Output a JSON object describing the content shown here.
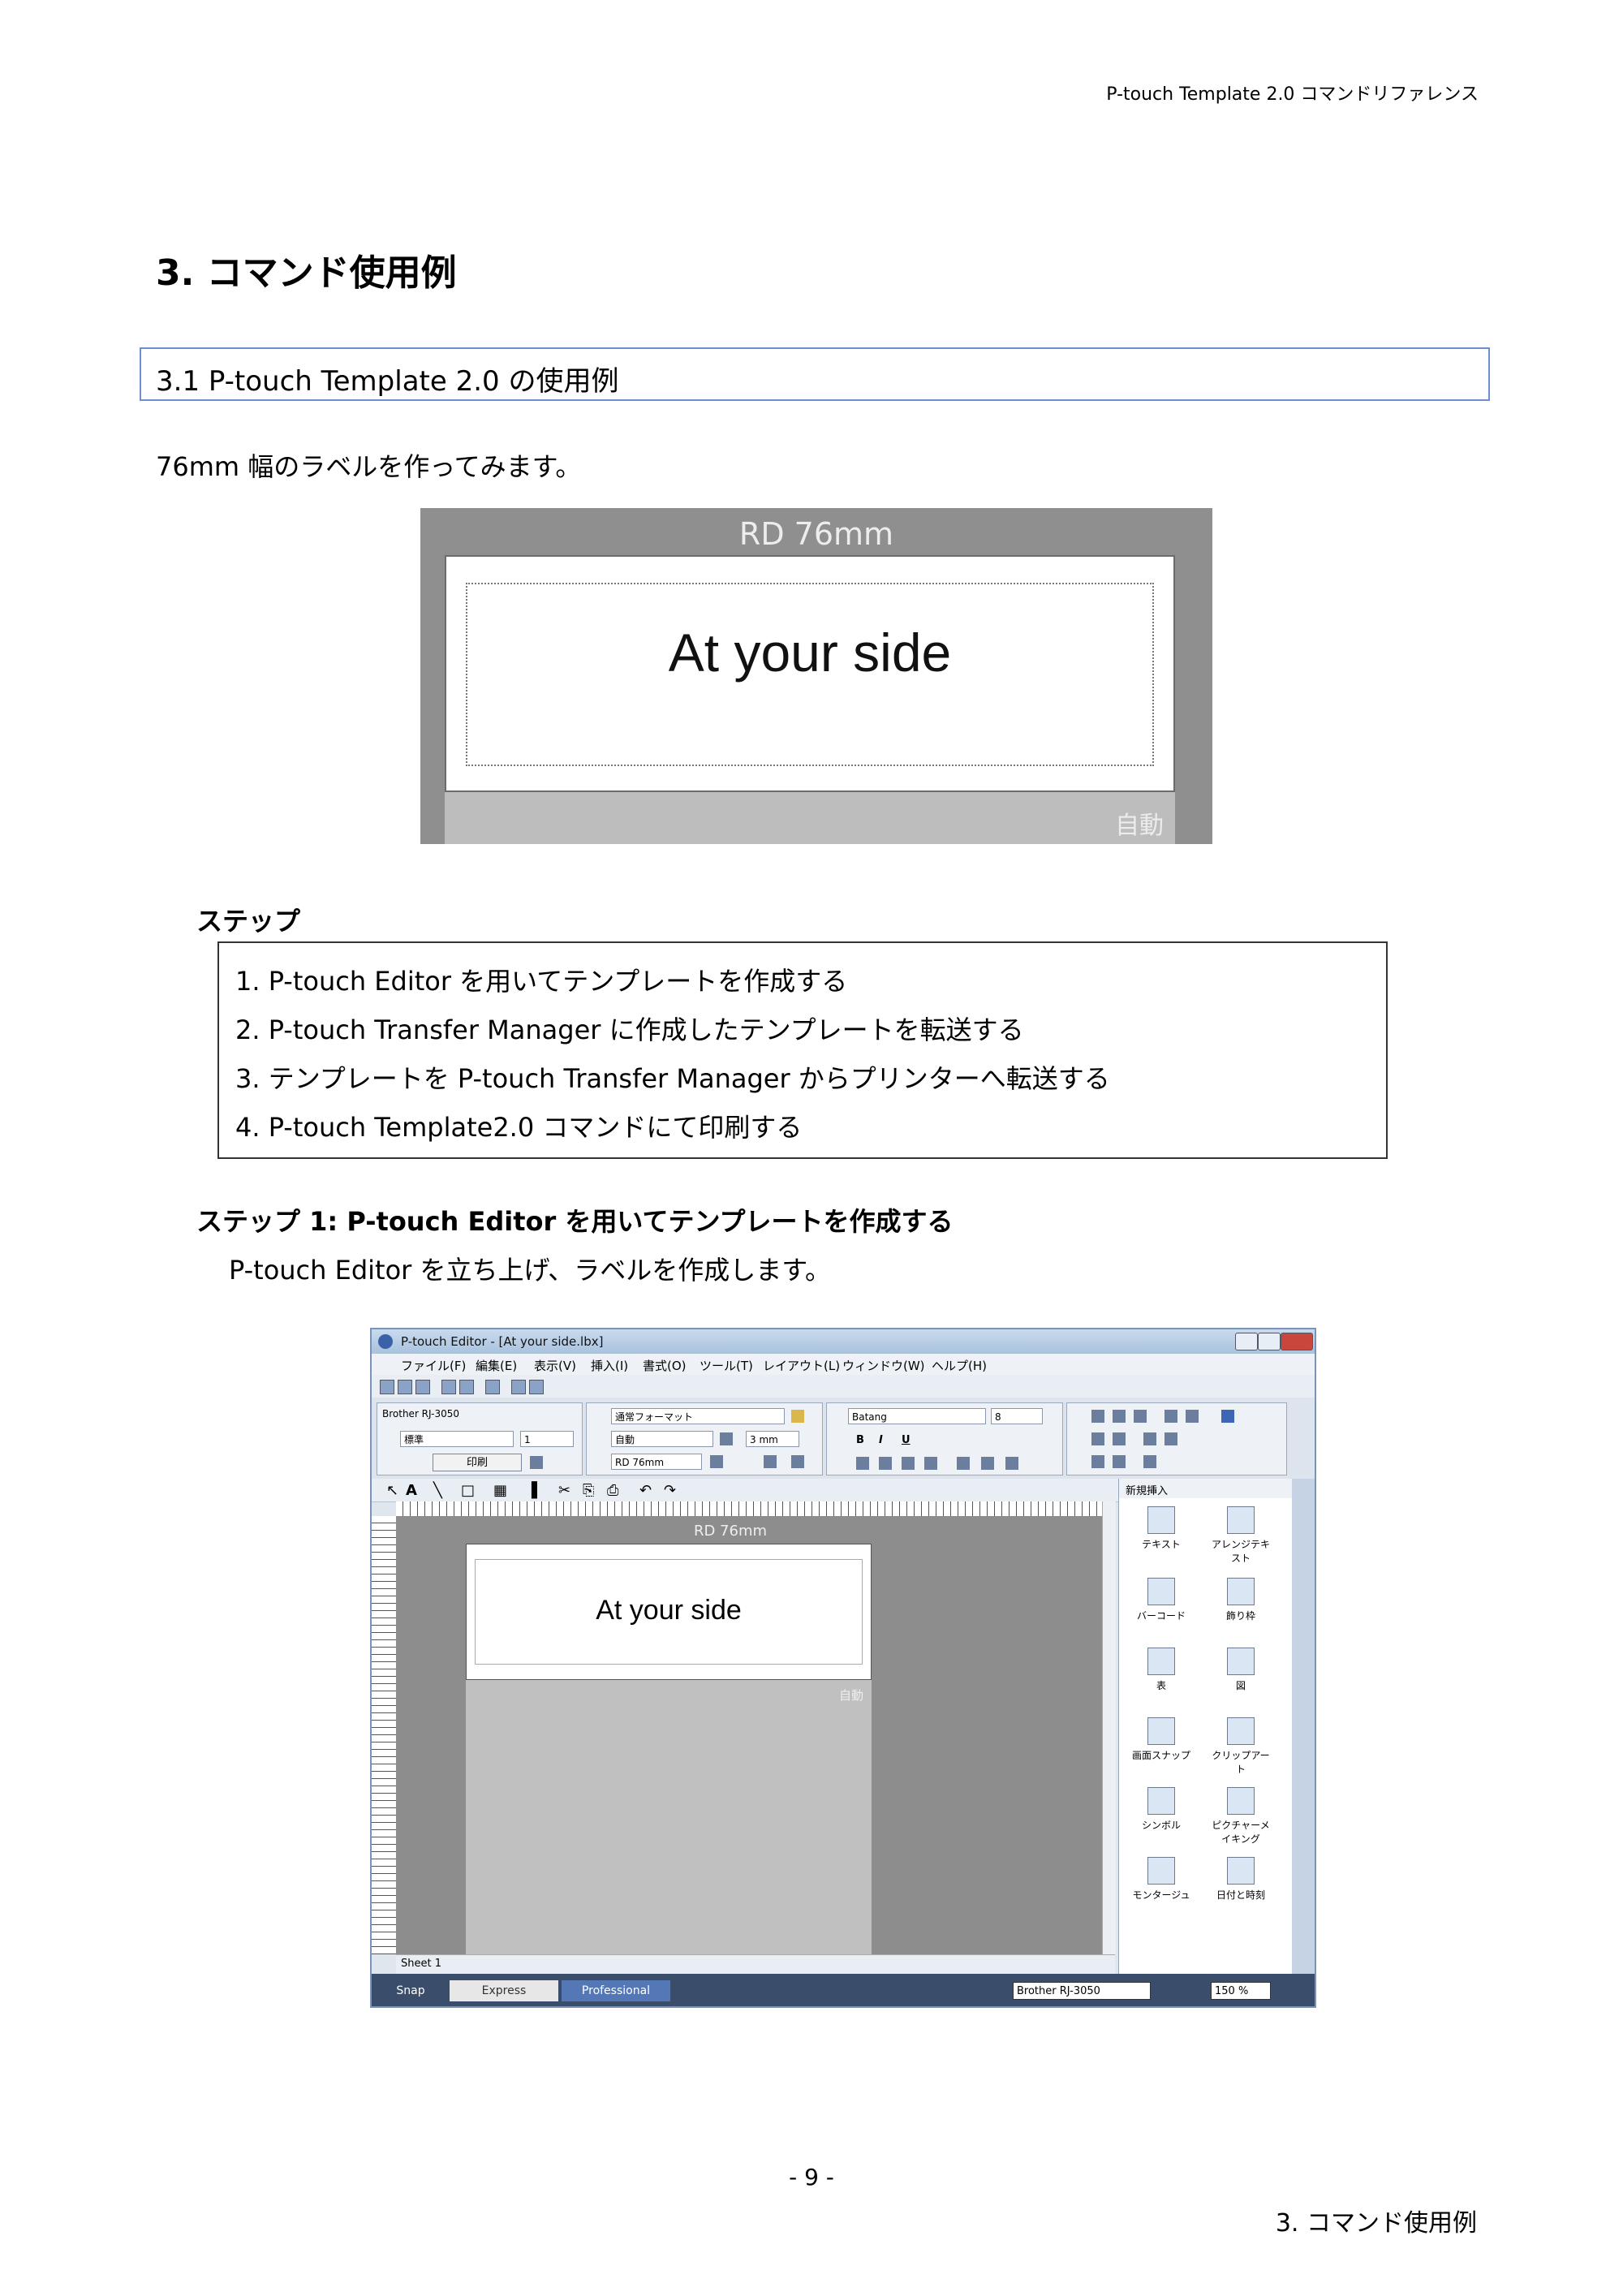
{
  "header": {
    "document_title": "P-touch Template 2.0  コマンドリファレンス"
  },
  "chapter": {
    "title": "3.  コマンド使用例"
  },
  "section": {
    "title": "3.1 P-touch Template 2.0 の使用例"
  },
  "intro": "76mm 幅のラベルを作ってみます。",
  "label_preview": {
    "tape_name": "RD 76mm",
    "text": "At your side",
    "length_mode": "自動"
  },
  "steps": {
    "heading": "ステップ",
    "items": [
      "1. P-touch Editor を用いてテンプレートを作成する",
      "2. P-touch Transfer Manager に作成したテンプレートを転送する",
      "3.  テンプレートを P-touch Transfer Manager からプリンターへ転送する",
      "4. P-touch Template2.0 コマンドにて印刷する"
    ]
  },
  "step1": {
    "heading": "ステップ 1: P-touch Editor  を用いてテンプレートを作成する",
    "description": "P-touch Editor を立ち上げ、ラベルを作成します。"
  },
  "editor": {
    "window_title": "P-touch Editor - [At your side.lbx]",
    "menu": [
      "ファイル(F)",
      "編集(E)",
      "表示(V)",
      "挿入(I)",
      "書式(O)",
      "ツール(T)",
      "レイアウト(L)",
      "ウィンドウ(W)",
      "ヘルプ(H)"
    ],
    "ribbon": {
      "printer": "Brother RJ-3050",
      "quality": "標準",
      "copies": "1",
      "print_button": "印刷",
      "format": "通常フォーマット",
      "length": "自動",
      "margin": "3 mm",
      "tape": "RD 76mm",
      "font": "Batang",
      "font_size": "8",
      "bold": "B",
      "italic": "I",
      "underline": "U"
    },
    "canvas": {
      "tape_name": "RD 76mm",
      "text": "At your side",
      "length_mode": "自動"
    },
    "sheet_tab": "Sheet 1",
    "panel": {
      "header": "新規挿入",
      "items": [
        "テキスト",
        "アレンジテキスト",
        "バーコード",
        "飾り枠",
        "表",
        "図",
        "画面スナップ",
        "クリップアート",
        "シンボル",
        "ピクチャーメイキング",
        "モンタージュ",
        "日付と時刻"
      ]
    },
    "status": {
      "modes": [
        "Snap",
        "Express",
        "Professional"
      ],
      "printer": "Brother RJ-3050",
      "zoom": "150 %"
    }
  },
  "footer": {
    "page_number": "- 9 -",
    "chapter": "3.  コマンド使用例"
  }
}
